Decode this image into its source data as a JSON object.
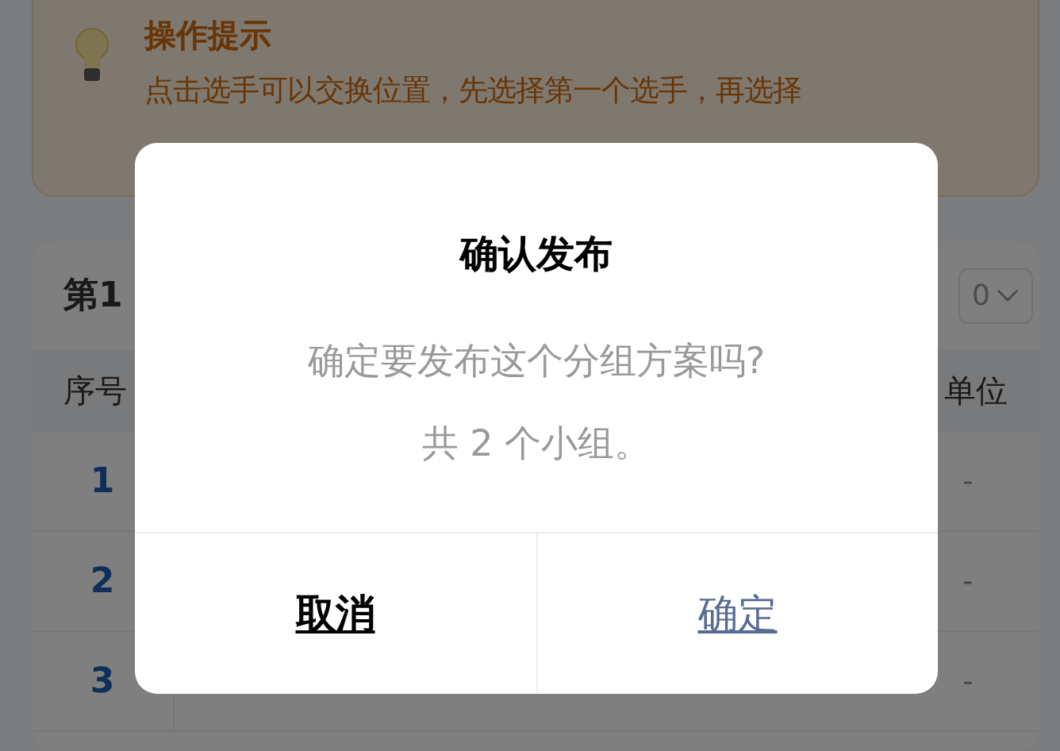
{
  "hint": {
    "title": "操作提示",
    "text": "点击选手可以交换位置，先选择第一个选手，再选择"
  },
  "group_card": {
    "title": "第1",
    "dropdown_value": "0",
    "columns": [
      "序号",
      "单位"
    ],
    "rows": [
      {
        "index": "1",
        "unit": "-"
      },
      {
        "index": "2",
        "unit": "-"
      },
      {
        "index": "3",
        "unit": "-"
      }
    ]
  },
  "dialog": {
    "title": "确认发布",
    "message_lines": [
      "确定要发布这个分组方案吗?",
      "共 2 个小组。"
    ],
    "buttons": [
      {
        "label": "取消",
        "kind": "cancel"
      },
      {
        "label": "确定",
        "kind": "confirm"
      }
    ]
  }
}
